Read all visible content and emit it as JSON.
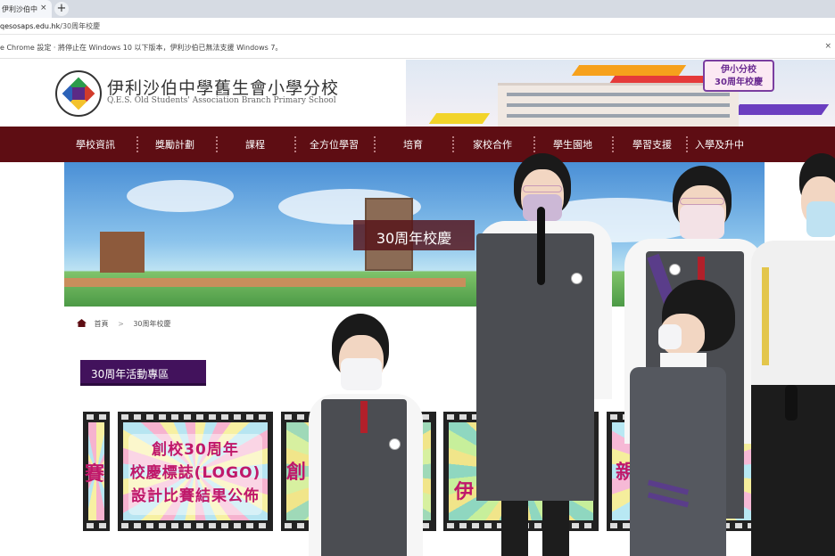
{
  "browser": {
    "tab_title": "伊利沙伯中",
    "tab_close": "×",
    "new_tab": "+",
    "url_host": "qesosaps.edu.hk",
    "url_path": "/30周年校慶",
    "url_prefix": "",
    "info_message": "e Chrome 設定 · 將停止在 Windows 10 以下版本，伊利沙伯已無法支援 Windows 7。",
    "info_close": "×"
  },
  "site": {
    "school_name_cn": "伊利沙伯中學舊生會小學分校",
    "school_name_en": "Q.E.S. Old Students' Association Branch Primary School",
    "anniversary_badge_line1": "伊小分校",
    "anniversary_badge_line2": "30周年校慶"
  },
  "nav": {
    "items": [
      {
        "label": "學校資訊"
      },
      {
        "label": "獎勵計劃"
      },
      {
        "label": "課程"
      },
      {
        "label": "全方位學習"
      },
      {
        "label": "培育"
      },
      {
        "label": "家校合作"
      },
      {
        "label": "學生園地"
      },
      {
        "label": "學習支援"
      },
      {
        "label": "入學及升中"
      }
    ]
  },
  "banner": {
    "title": "30周年校慶"
  },
  "breadcrumb": {
    "home": "首頁",
    "separator": ">",
    "current": "30周年校慶"
  },
  "section": {
    "title": "30周年活動專區"
  },
  "cards": [
    {
      "partial_text": "賽"
    },
    {
      "lines": [
        "創校30周年",
        "校慶標誌(LOGO)",
        "設計比賽結果公佈"
      ]
    },
    {
      "partial_text": "創"
    },
    {
      "partial_text": "伊"
    },
    {
      "partial_text": "親子"
    }
  ],
  "colors": {
    "nav_bg": "#5e0d13",
    "section_title_bg": "#42125c",
    "card_text": "#c0186a"
  }
}
